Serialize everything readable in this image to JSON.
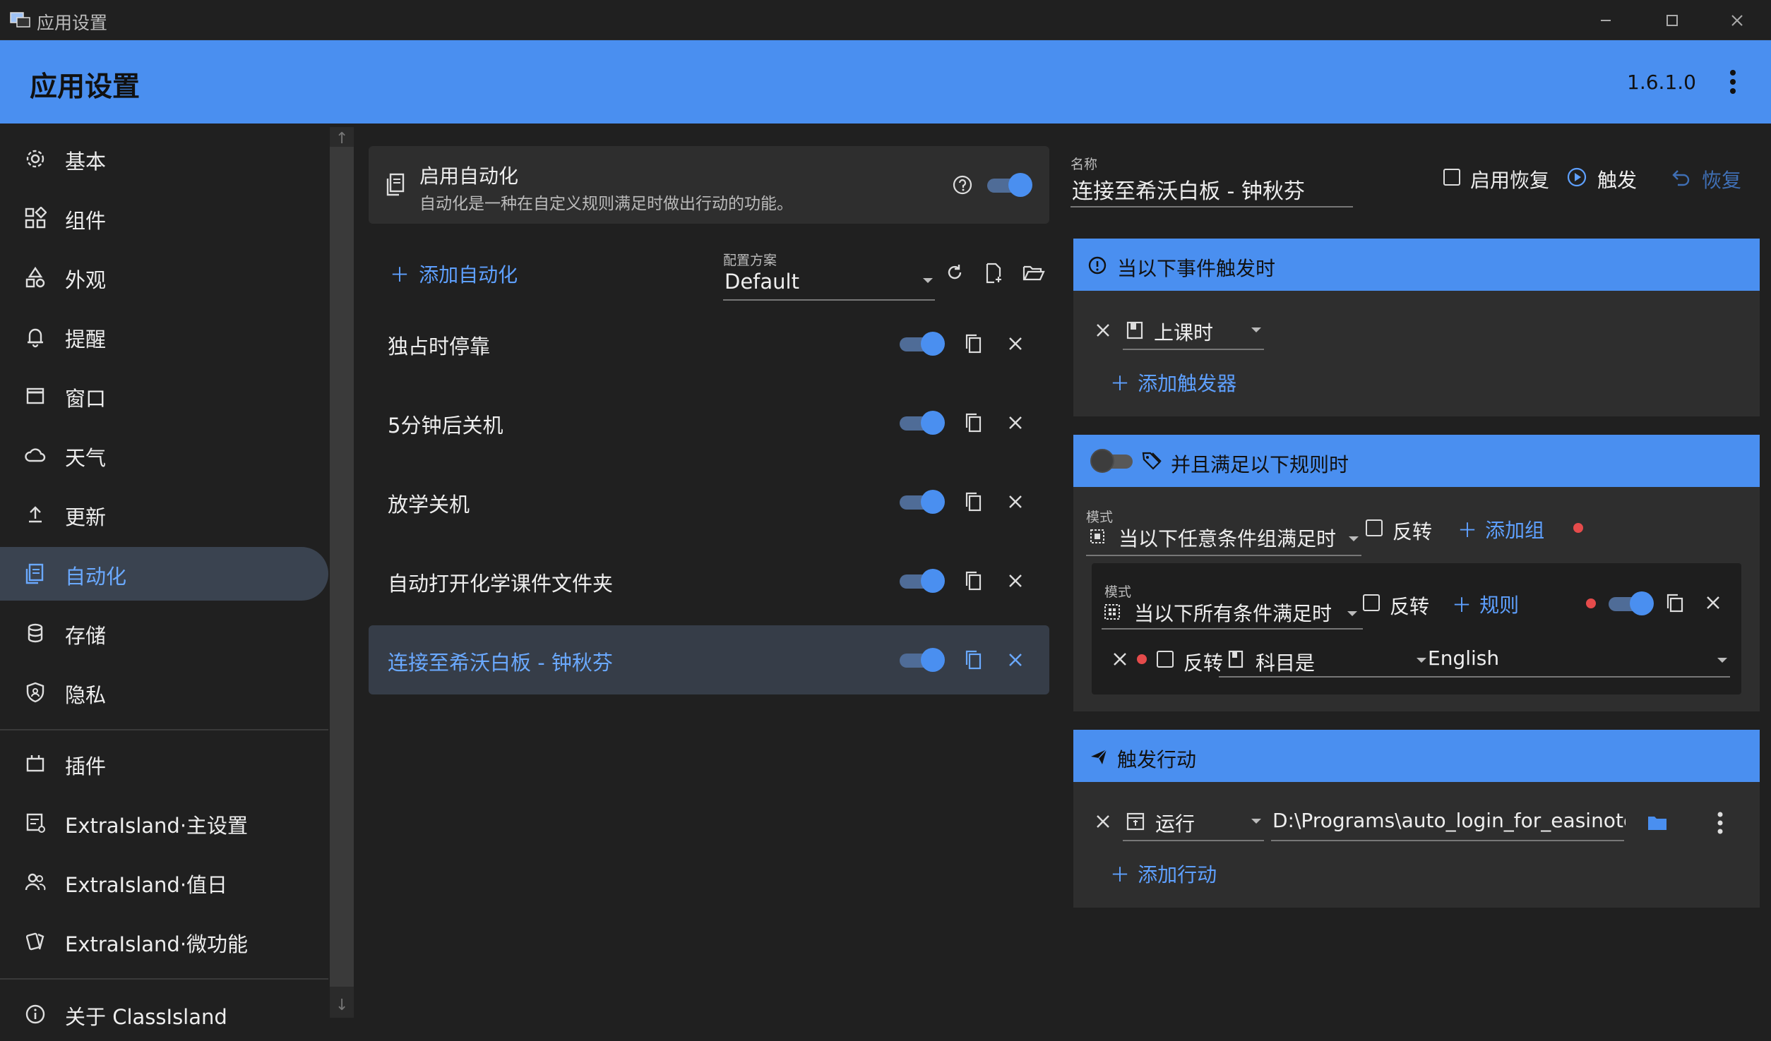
{
  "window": {
    "title": "应用设置"
  },
  "header": {
    "title": "应用设置",
    "version": "1.6.1.0"
  },
  "sidebar": {
    "items": [
      {
        "label": "基本",
        "icon": "gear-icon"
      },
      {
        "label": "组件",
        "icon": "widgets-icon"
      },
      {
        "label": "外观",
        "icon": "shapes-icon"
      },
      {
        "label": "提醒",
        "icon": "bell-icon"
      },
      {
        "label": "窗口",
        "icon": "window-icon"
      },
      {
        "label": "天气",
        "icon": "cloud-icon"
      },
      {
        "label": "更新",
        "icon": "upload-icon"
      },
      {
        "label": "自动化",
        "icon": "automation-icon",
        "selected": true
      },
      {
        "label": "存储",
        "icon": "database-icon"
      },
      {
        "label": "隐私",
        "icon": "shield-icon"
      },
      {
        "label": "插件",
        "icon": "plugin-icon"
      },
      {
        "label": "ExtraIsland·主设置",
        "icon": "settings-doc-icon"
      },
      {
        "label": "ExtraIsland·值日",
        "icon": "people-icon"
      },
      {
        "label": "ExtraIsland·微功能",
        "icon": "cards-icon"
      },
      {
        "label": "关于 ClassIsland",
        "icon": "info-icon"
      }
    ]
  },
  "automation": {
    "enable_title": "启用自动化",
    "enable_desc": "自动化是一种在自定义规则满足时做出行动的功能。",
    "enabled": true,
    "add_label": "添加自动化",
    "profile_label": "配置方案",
    "profile_value": "Default",
    "items": [
      {
        "name": "独占时停靠",
        "enabled": true
      },
      {
        "name": "5分钟后关机",
        "enabled": true
      },
      {
        "name": "放学关机",
        "enabled": true
      },
      {
        "name": "自动打开化学课件文件夹",
        "enabled": true
      },
      {
        "name": "连接至希沃白板 - 钟秋芬",
        "enabled": true,
        "selected": true
      }
    ]
  },
  "detail": {
    "name_label": "名称",
    "name_value": "连接至希沃白板 - 钟秋芬",
    "enable_restore_label": "启用恢复",
    "trigger_label": "触发",
    "restore_label": "恢复",
    "events_head": "当以下事件触发时",
    "event_value": "上课时",
    "add_trigger_label": "添加触发器",
    "rules_head": "并且满足以下规则时",
    "rules_enabled": false,
    "mode_label": "模式",
    "mode_value": "当以下任意条件组满足时",
    "invert_label": "反转",
    "add_group_label": "添加组",
    "group": {
      "mode_label": "模式",
      "mode_value": "当以下所有条件满足时",
      "invert_label": "反转",
      "rule_label": "规则",
      "enabled": true,
      "rule": {
        "invert_label": "反转",
        "subject_label": "科目是",
        "subject_value": "English"
      }
    },
    "actions_head": "触发行动",
    "action_type": "运行",
    "action_path": "D:\\Programs\\auto_login_for_easinote.ex",
    "add_action_label": "添加行动"
  },
  "colors": {
    "accent": "#4a8ff0",
    "link": "#5ea0ff",
    "dot": "#e54b4b"
  }
}
